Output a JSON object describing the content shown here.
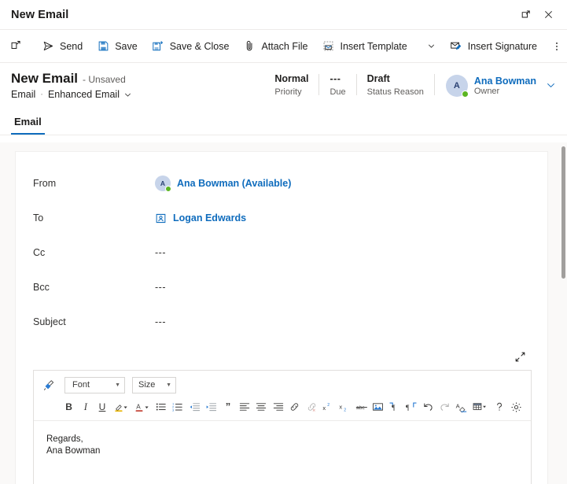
{
  "window": {
    "title": "New Email",
    "popout_icon": "popout-icon",
    "close_icon": "close-icon"
  },
  "commandbar": {
    "new_window_icon": "open-in-new-window-icon",
    "items": [
      {
        "label": "Send",
        "icon": "send-icon"
      },
      {
        "label": "Save",
        "icon": "save-icon"
      },
      {
        "label": "Save & Close",
        "icon": "save-and-close-icon"
      },
      {
        "label": "Attach File",
        "icon": "paperclip-icon"
      },
      {
        "label": "Insert Template",
        "icon": "insert-template-icon"
      },
      {
        "label": "Insert Signature",
        "icon": "insert-signature-icon"
      }
    ],
    "template_chevron_icon": "chevron-down-icon",
    "overflow_icon": "more-commands-icon"
  },
  "record_header": {
    "title": "New Email",
    "unsaved_label": "- Unsaved",
    "breadcrumb_entity": "Email",
    "breadcrumb_separator": "·",
    "breadcrumb_form": "Enhanced Email",
    "form_chevron_icon": "chevron-down-icon",
    "fields": [
      {
        "value": "Normal",
        "label": "Priority"
      },
      {
        "value": "---",
        "label": "Due"
      },
      {
        "value": "Draft",
        "label": "Status Reason"
      }
    ],
    "owner": {
      "initial": "A",
      "name": "Ana Bowman",
      "role": "Owner",
      "presence": "available",
      "chevron_icon": "chevron-down-icon"
    }
  },
  "tabs": [
    {
      "label": "Email",
      "active": true
    }
  ],
  "form": {
    "rows": [
      {
        "label": "From",
        "type": "person",
        "initial": "A",
        "value": "Ana Bowman (Available)"
      },
      {
        "label": "To",
        "type": "lookup",
        "icon": "contact-card-icon",
        "value": "Logan Edwards"
      },
      {
        "label": "Cc",
        "type": "empty",
        "value": "---"
      },
      {
        "label": "Bcc",
        "type": "empty",
        "value": "---"
      },
      {
        "label": "Subject",
        "type": "empty",
        "value": "---"
      }
    ],
    "expand_icon": "expand-editor-icon"
  },
  "editor": {
    "format_painter_icon": "format-painter-icon",
    "font_select": {
      "value": "Font",
      "caret": "chevron-down-icon"
    },
    "size_select": {
      "value": "Size",
      "caret": "chevron-down-icon"
    },
    "buttons": [
      {
        "name": "bold-icon",
        "glyph": "B"
      },
      {
        "name": "italic-icon",
        "glyph": "I"
      },
      {
        "name": "underline-icon",
        "glyph": "U"
      },
      {
        "name": "text-highlight-icon",
        "glyph": "pen"
      },
      {
        "name": "font-color-icon",
        "glyph": "A"
      },
      {
        "name": "bulleted-list-icon",
        "glyph": "ul"
      },
      {
        "name": "numbered-list-icon",
        "glyph": "ol"
      },
      {
        "name": "decrease-indent-icon",
        "glyph": "outdent"
      },
      {
        "name": "increase-indent-icon",
        "glyph": "indent"
      },
      {
        "name": "blockquote-icon",
        "glyph": "”"
      },
      {
        "name": "align-left-icon",
        "glyph": "alignleft"
      },
      {
        "name": "align-center-icon",
        "glyph": "aligncenter"
      },
      {
        "name": "align-right-icon",
        "glyph": "alignright"
      },
      {
        "name": "insert-link-icon",
        "glyph": "link"
      },
      {
        "name": "remove-link-icon",
        "glyph": "unlink"
      },
      {
        "name": "superscript-icon",
        "glyph": "x2sup"
      },
      {
        "name": "subscript-icon",
        "glyph": "x2sub"
      },
      {
        "name": "strikethrough-icon",
        "glyph": "abc"
      },
      {
        "name": "insert-image-icon",
        "glyph": "image"
      },
      {
        "name": "left-to-right-icon",
        "glyph": "ltr"
      },
      {
        "name": "right-to-left-icon",
        "glyph": "rtl"
      },
      {
        "name": "undo-icon",
        "glyph": "undo"
      },
      {
        "name": "redo-icon",
        "glyph": "redo"
      },
      {
        "name": "clear-formatting-icon",
        "glyph": "eraser"
      },
      {
        "name": "insert-table-icon",
        "glyph": "table"
      },
      {
        "name": "help-icon",
        "glyph": "?"
      },
      {
        "name": "editor-settings-icon",
        "glyph": "gear"
      }
    ],
    "body_lines": [
      "Regards,",
      "Ana Bowman"
    ]
  },
  "colors": {
    "accent": "#0f6cbd",
    "canvas_bg": "#faf9f8",
    "card_bg": "#ffffff",
    "presence_available": "#5bb522",
    "avatar_bg": "#c7d4ea",
    "border": "#e1dfdd"
  }
}
